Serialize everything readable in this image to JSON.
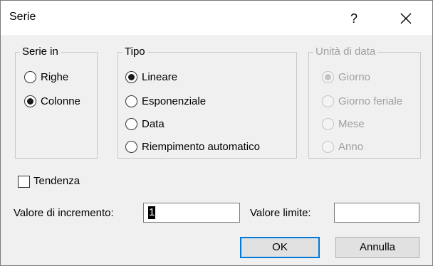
{
  "window": {
    "title": "Serie",
    "help_glyph": "?",
    "close_glyph": "×"
  },
  "serie_in": {
    "label": "Serie in",
    "options": [
      {
        "label": "Righe",
        "selected": false
      },
      {
        "label": "Colonne",
        "selected": true
      }
    ]
  },
  "tipo": {
    "label": "Tipo",
    "options": [
      {
        "label": "Lineare",
        "selected": true
      },
      {
        "label": "Esponenziale",
        "selected": false
      },
      {
        "label": "Data",
        "selected": false
      },
      {
        "label": "Riempimento automatico",
        "selected": false
      }
    ]
  },
  "unita_di_data": {
    "label": "Unità di data",
    "enabled": false,
    "options": [
      {
        "label": "Giorno",
        "selected": true
      },
      {
        "label": "Giorno feriale",
        "selected": false
      },
      {
        "label": "Mese",
        "selected": false
      },
      {
        "label": "Anno",
        "selected": false
      }
    ]
  },
  "tendenza": {
    "label": "Tendenza",
    "checked": false
  },
  "valore_incremento": {
    "label": "Valore di incremento:",
    "value": "1"
  },
  "valore_limite": {
    "label": "Valore limite:",
    "value": ""
  },
  "buttons": {
    "ok": "OK",
    "cancel": "Annulla"
  },
  "colors": {
    "accent": "#0078d7",
    "disabled_text": "#a0a0a0"
  }
}
